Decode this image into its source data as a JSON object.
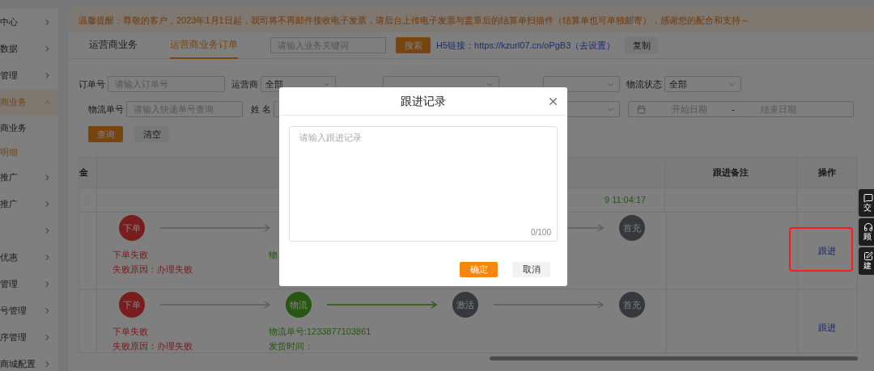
{
  "sidebar": {
    "items": [
      {
        "label": "中心",
        "expanded": false
      },
      {
        "label": "数据",
        "expanded": false
      },
      {
        "label": "管理",
        "expanded": false
      },
      {
        "label": "商业务",
        "expanded": true,
        "children": [
          {
            "label": "商业务",
            "selected": false
          },
          {
            "label": "明细",
            "selected": true
          }
        ]
      },
      {
        "label": "推广",
        "expanded": false
      },
      {
        "label": "推广",
        "expanded": false
      },
      {
        "expanded": false
      },
      {
        "label": "优惠",
        "expanded": false
      },
      {
        "label": "管理",
        "expanded": false
      },
      {
        "label": "号管理",
        "expanded": false
      },
      {
        "label": "序管理",
        "expanded": false
      },
      {
        "label": "商城配置",
        "expanded": false
      }
    ]
  },
  "notice": "温馨提醒：尊敬的客户，2023年1月1日起，我司将不再邮件接收电子发票，请后台上传电子发票与盖章后的结算单扫描件（结算单也可单独邮寄），感谢您的配合和支持～",
  "tabs": [
    {
      "label": "运营商业务",
      "selected": false
    },
    {
      "label": "运营商业务订单",
      "selected": true
    }
  ],
  "search": {
    "placeholder": "请输入业务关键词",
    "button": "搜索"
  },
  "h5": {
    "label": "H5链接：",
    "link": "https://kzurl07.cn/oPgB3（去设置）",
    "copy": "复制"
  },
  "filters": {
    "row_1": [
      {
        "kind": "input",
        "label": "订单号",
        "placeholder": "请输入订单号"
      },
      {
        "kind": "select",
        "label": "运营商",
        "value": "全部"
      },
      {
        "kind": "select"
      },
      {
        "kind": "select"
      },
      {
        "kind": "select",
        "label": "物流状态",
        "value": "全部"
      }
    ],
    "row_2": [
      {
        "kind": "input",
        "label": "物流单号",
        "placeholder": "请输入快递单号查询"
      },
      {
        "kind": "input",
        "label": "姓 名"
      },
      {
        "kind": "select"
      },
      {
        "kind": "date",
        "start": "开始日期",
        "separator": "-",
        "end": "结束日期"
      }
    ],
    "buttons": [
      "查询",
      "清空"
    ]
  },
  "table": {
    "columns": [
      "金",
      "跟进备注",
      "操作"
    ],
    "rows": [
      {
        "time": "9 11:04:17",
        "highlighted": false
      },
      {
        "steps": [
          {
            "label": "下单",
            "kind": "failed",
            "lines": [
              "下单失败",
              "失败原因：办理失败"
            ],
            "arrow": true
          },
          {
            "kind": "done",
            "lines": [
              "物"
            ],
            "arrow": false
          },
          {
            "kind": "pending",
            "arrow": true
          },
          {
            "label": "首充",
            "kind": "pending"
          }
        ],
        "action": "跟进",
        "highlighted": true
      },
      {
        "steps": [
          {
            "label": "下单",
            "kind": "failed",
            "lines": [
              "下单失败",
              "失败原因：办理失败"
            ],
            "arrow": true
          },
          {
            "label": "物流",
            "kind": "done",
            "lines": [
              "物流单号:1233877103861",
              "发货时间："
            ],
            "arrow": true
          },
          {
            "label": "激活",
            "kind": "pending",
            "arrow": true
          },
          {
            "label": "首充",
            "kind": "pending"
          }
        ],
        "action": "跟进",
        "highlighted": false
      }
    ]
  },
  "side_tabs": [
    {
      "label": "交",
      "kind": "chat"
    },
    {
      "label": "顾",
      "kind": "headset"
    },
    {
      "label": "建",
      "kind": "edit"
    }
  ],
  "dialog": {
    "title": "跟进记录",
    "placeholder": "请输入跟进记录",
    "counter": "0/100",
    "confirm": "确定",
    "cancel": "取消"
  }
}
